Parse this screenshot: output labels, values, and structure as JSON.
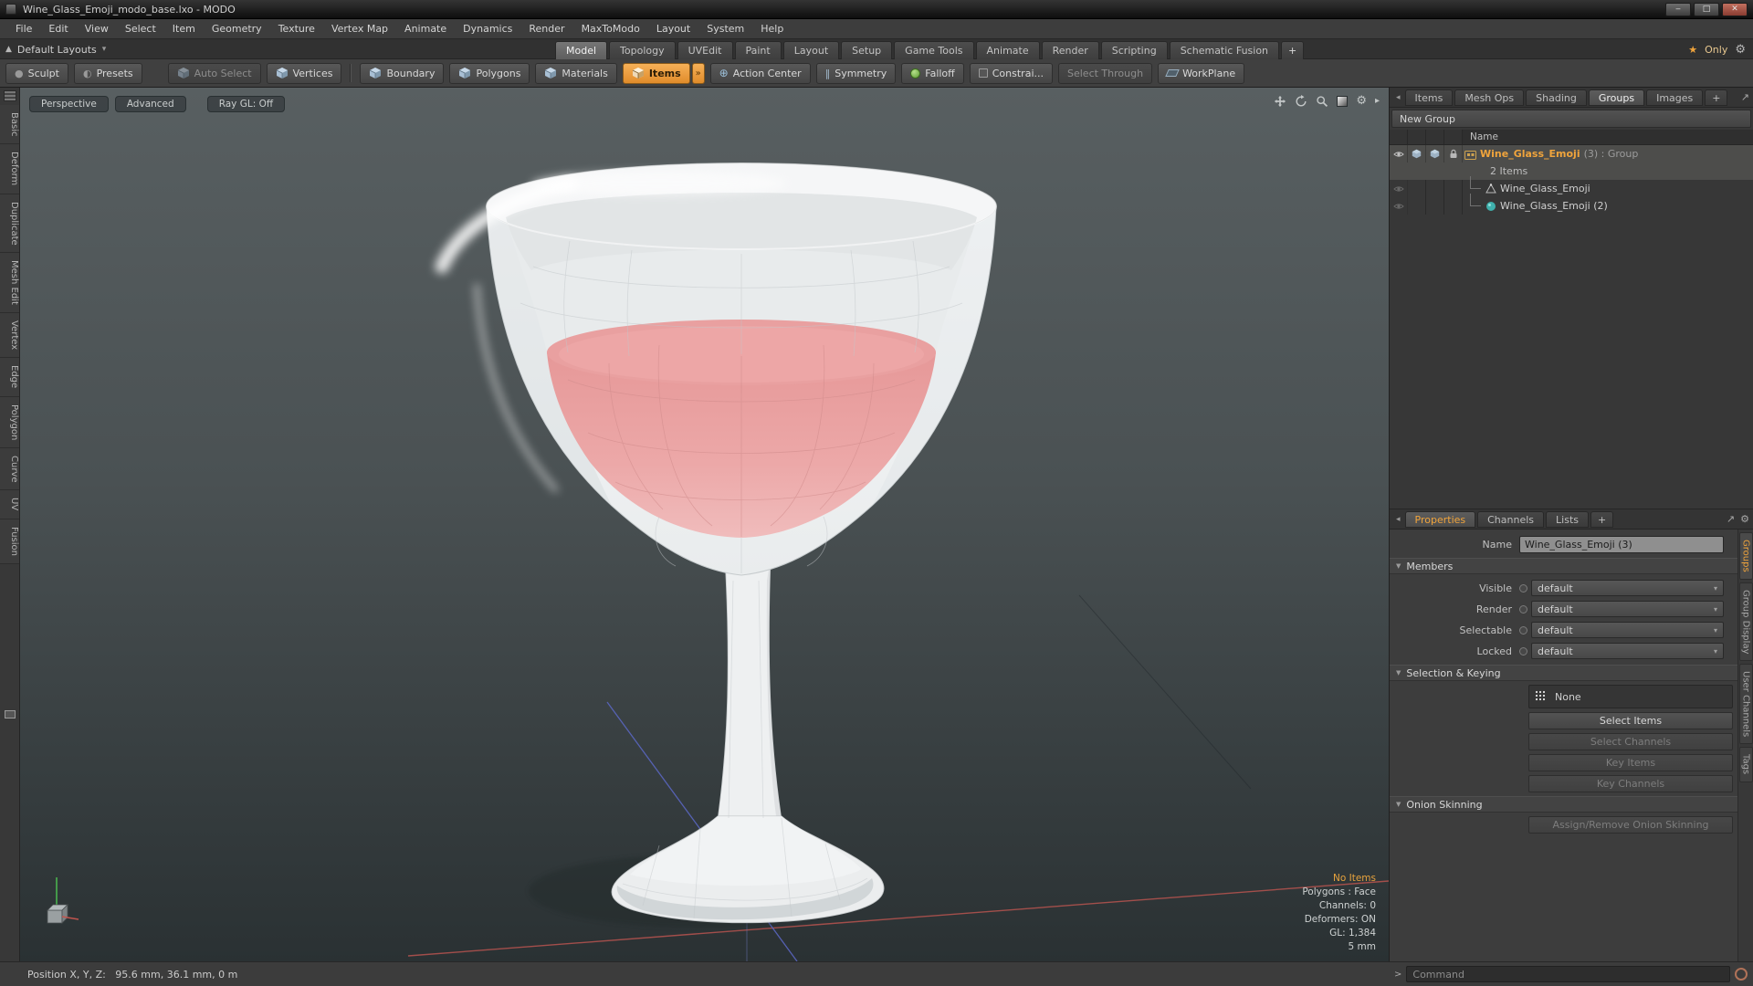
{
  "glyphs": {
    "minimize": "‒",
    "maximize": "□",
    "close": "✕",
    "dropdown": "▾",
    "section": "▼",
    "star": "★",
    "gear": "⚙",
    "more": "»",
    "back": "◂",
    "expand": "↗",
    "up": "▲",
    "prompt": ">",
    "play": "▸",
    "action": "⊕",
    "symmetry": "‖",
    "presets": "◐",
    "sculpt": "●"
  },
  "window": {
    "title": "Wine_Glass_Emoji_modo_base.lxo - MODO"
  },
  "menu": {
    "items": [
      "File",
      "Edit",
      "View",
      "Select",
      "Item",
      "Geometry",
      "Texture",
      "Vertex Map",
      "Animate",
      "Dynamics",
      "Render",
      "MaxToModo",
      "Layout",
      "System",
      "Help"
    ]
  },
  "layout_bar": {
    "layouts_label": "Default Layouts",
    "tabs": [
      "Model",
      "Topology",
      "UVEdit",
      "Paint",
      "Layout",
      "Setup",
      "Game Tools",
      "Animate",
      "Render",
      "Scripting",
      "Schematic Fusion"
    ],
    "add_tab": "+",
    "active_tab": "Model",
    "only_label": "Only"
  },
  "toolbar": {
    "sculpt": "Sculpt",
    "presets": "Presets",
    "auto_select": "Auto Select",
    "vertices": "Vertices",
    "boundary": "Boundary",
    "polygons": "Polygons",
    "materials": "Materials",
    "items": "Items",
    "action_center": "Action Center",
    "symmetry": "Symmetry",
    "falloff": "Falloff",
    "constraints": "Constrai...",
    "select_through": "Select Through",
    "workplane": "WorkPlane"
  },
  "left_toolbox": {
    "tabs": [
      "Basic",
      "Deform",
      "Duplicate",
      "Mesh Edit",
      "Vertex",
      "Edge",
      "Polygon",
      "Curve",
      "UV",
      "Fusion"
    ]
  },
  "viewport": {
    "mode_tabs": [
      "Perspective",
      "Advanced",
      "Ray GL: Off"
    ],
    "stats": [
      "No Items",
      "Polygons : Face",
      "Channels: 0",
      "Deformers: ON",
      "GL: 1,384",
      "5 mm"
    ]
  },
  "item_list": {
    "tabs": [
      "Items",
      "Mesh Ops",
      "Shading",
      "Groups",
      "Images"
    ],
    "active_tab": "Groups",
    "add_tab": "+",
    "new_group_button": "New Group",
    "name_header": "Name",
    "group_name": "Wine_Glass_Emoji",
    "group_suffix": "(3) : Group",
    "group_count": "2 Items",
    "child1": "Wine_Glass_Emoji",
    "child2": "Wine_Glass_Emoji (2)"
  },
  "properties": {
    "tabs": [
      "Properties",
      "Channels",
      "Lists"
    ],
    "active_tab": "Properties",
    "add_tab": "+",
    "name_label": "Name",
    "name_value": "Wine_Glass_Emoji (3)",
    "sections": {
      "members": "Members",
      "selection_keying": "Selection & Keying",
      "onion_skinning": "Onion Skinning"
    },
    "rows": [
      {
        "label": "Visible",
        "value": "default"
      },
      {
        "label": "Render",
        "value": "default"
      },
      {
        "label": "Selectable",
        "value": "default"
      },
      {
        "label": "Locked",
        "value": "default"
      }
    ],
    "none_button": "None",
    "buttons": [
      "Select Items",
      "Select Channels",
      "Key Items",
      "Key Channels"
    ],
    "onion_button": "Assign/Remove Onion Skinning",
    "side_tabs": [
      "Groups",
      "Group Display",
      "User Channels",
      "Tags"
    ]
  },
  "status_bar": {
    "position": "Position X, Y, Z:   95.6 mm, 36.1 mm, 0 m",
    "command_placeholder": "Command"
  },
  "colors": {
    "accent_orange": "#f0a43c",
    "wine_pink": "#eba2a2",
    "axis_red": "#b0524e",
    "axis_blue": "#5a66c0",
    "axis_green": "#49b34f",
    "viewport_top": "#585f61",
    "viewport_bottom": "#2a3133"
  }
}
